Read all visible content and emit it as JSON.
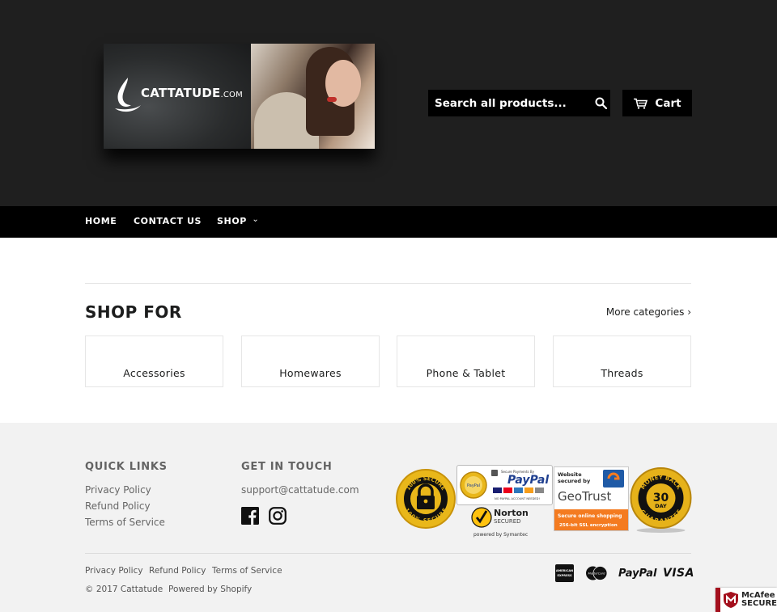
{
  "header": {
    "logo": {
      "brand": "CATTATUDE",
      "suffix": ".COM"
    },
    "search": {
      "placeholder": "Search all products...",
      "icon": "search-icon"
    },
    "cart": {
      "label": "Cart",
      "icon": "cart-icon"
    }
  },
  "nav": {
    "items": [
      {
        "label": "HOME"
      },
      {
        "label": "CONTACT US"
      },
      {
        "label": "SHOP",
        "caret": "⌄"
      }
    ]
  },
  "main": {
    "title": "SHOP FOR",
    "more_link": "More categories ›",
    "categories": [
      "Accessories",
      "Homewares",
      "Phone & Tablet",
      "Threads"
    ]
  },
  "footer": {
    "quick_links": {
      "heading": "QUICK LINKS",
      "links": [
        "Privacy Policy",
        "Refund Policy",
        "Terms of Service"
      ]
    },
    "get_in_touch": {
      "heading": "GET IN TOUCH",
      "email": "support@cattatude.com",
      "social": [
        "facebook-icon",
        "instagram-icon"
      ]
    },
    "badges": {
      "secure": {
        "top": "100% SECURE",
        "bottom": "100% SECURE"
      },
      "paypal": {
        "caption": "Secure Payments By",
        "name": "PayPal",
        "note": "NO PAYPAL ACCOUNT NEEDED!"
      },
      "norton": {
        "name": "Norton",
        "sub": "SECURED",
        "by": "powered by Symantec"
      },
      "geotrust": {
        "line1": "Website",
        "line2": "secured by",
        "name": "GeoTrust",
        "band1": "Secure online shopping",
        "band2": "256-bit SSL encryption"
      },
      "guarantee": {
        "top": "MONEY BACK",
        "days": "30",
        "unit": "DAY",
        "bottom": "GUARANTEE"
      }
    },
    "bottom_links": [
      "Privacy Policy",
      "Refund Policy",
      "Terms of Service"
    ],
    "copyright": "© 2017 Cattatude",
    "powered_by": "Powered by Shopify",
    "payment_icons": [
      "american-express-icon",
      "mastercard-icon",
      "paypal-icon",
      "visa-icon"
    ],
    "payment_labels": {
      "amex": "AMERICAN EXPRESS",
      "paypal": "PayPal",
      "visa": "VISA"
    }
  },
  "mcafee": {
    "line1": "McAfee",
    "line2": "SECURE"
  },
  "colors": {
    "header_bg": "#1f1f1f",
    "nav_bg": "#000000",
    "footer_bg": "#f2f2f2",
    "badge_gold": "#e9b71a",
    "mcafee_red": "#a4101d"
  }
}
